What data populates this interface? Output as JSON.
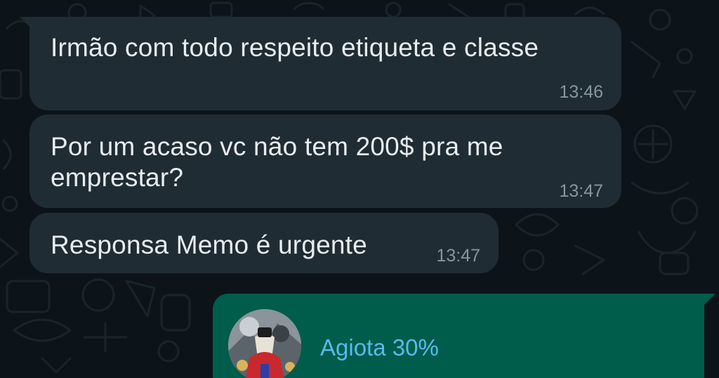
{
  "messages": [
    {
      "text": "Irmão com todo respeito etiqueta e classe",
      "time": "13:46"
    },
    {
      "text_line1": "Por um acaso vc não tem 200$ pra me",
      "text_line2": "emprestar?",
      "time": "13:47"
    },
    {
      "text": "Responsa Memo é urgente",
      "time": "13:47"
    }
  ],
  "outgoing": {
    "contact_name": "Agiota 30%",
    "avatar_icon": "contact-avatar-image"
  },
  "colors": {
    "background": "#0c1419",
    "incoming_bubble": "#1f2c34",
    "outgoing_bubble": "#005c4b",
    "text": "#e9edef",
    "timestamp": "#8696a0",
    "contact_name": "#53bdeb"
  }
}
